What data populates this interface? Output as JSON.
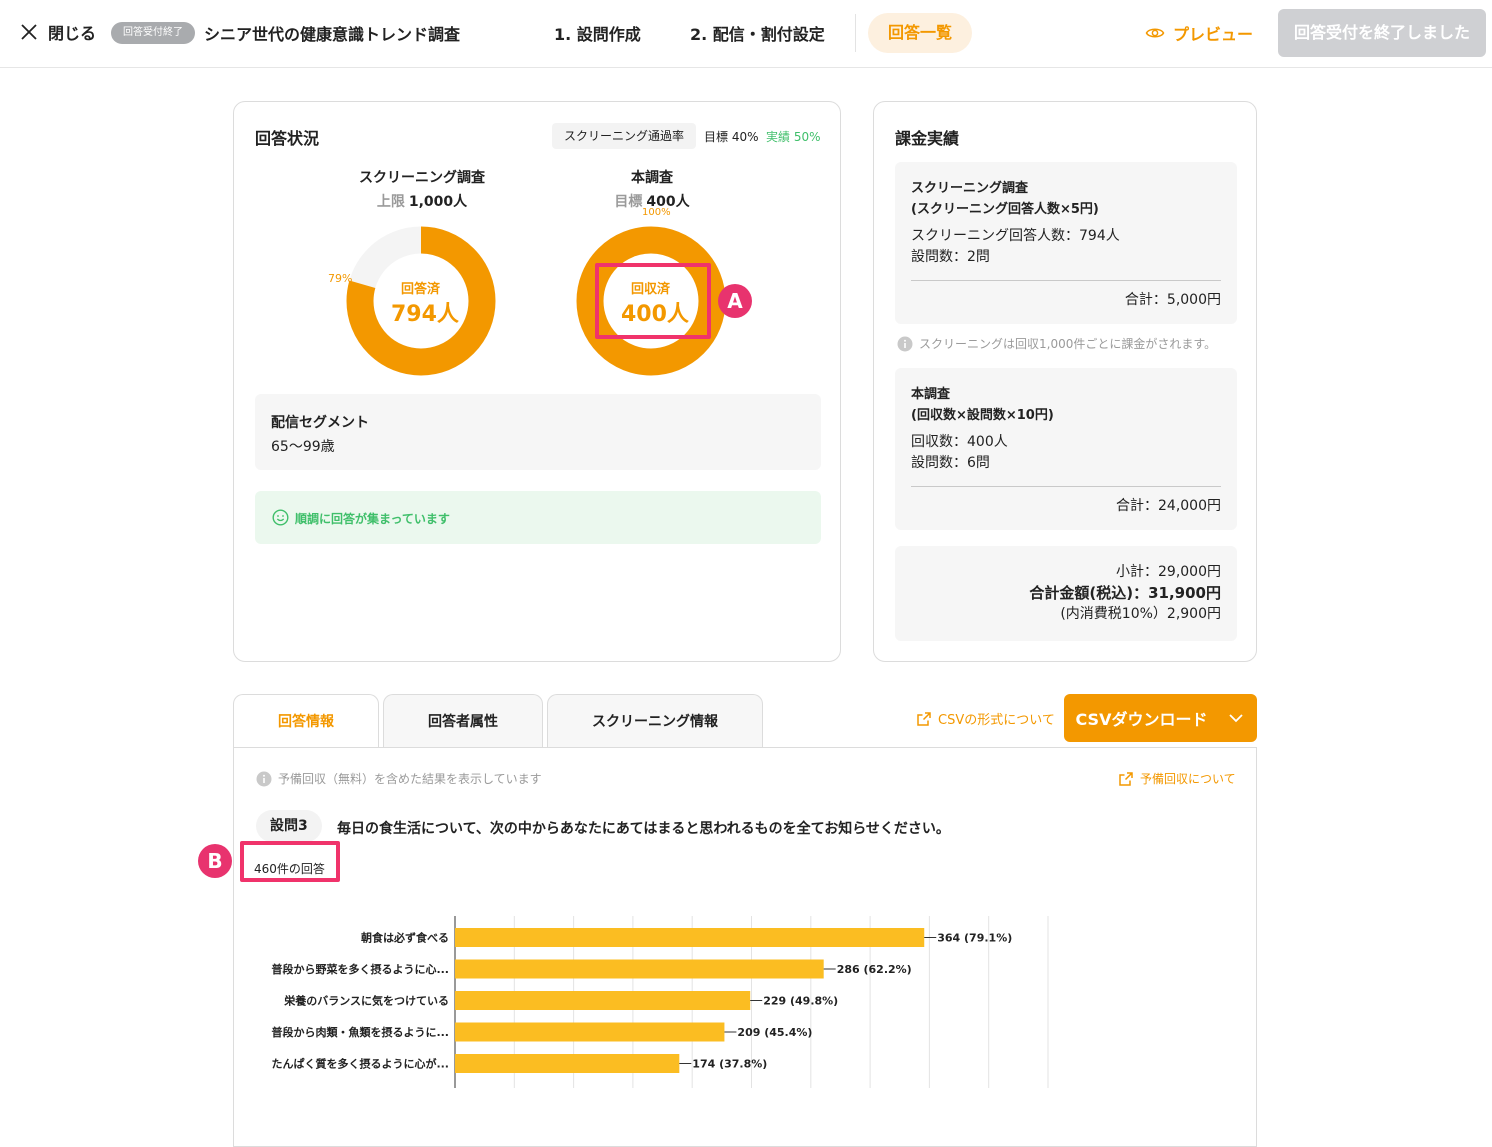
{
  "header": {
    "close_label": "閉じる",
    "status_badge": "回答受付終了",
    "survey_title": "シニア世代の健康意識トレンド調査",
    "step1": "1. 設問作成",
    "step2": "2. 配信・割付設定",
    "active_tab": "回答一覧",
    "preview_label": "プレビュー",
    "end_button": "回答受付を終了しました"
  },
  "status": {
    "title": "回答状況",
    "rate_label": "スクリーニング通過率",
    "rate_target": "目標 40%",
    "rate_actual": "実績 50%",
    "screening": {
      "head": "スクリーニング調査",
      "sub_key": "上限",
      "sub_val": "1,000人",
      "pct_label": "79%",
      "center_key": "回答済",
      "center_val": "794人",
      "fraction": 0.794
    },
    "main": {
      "head": "本調査",
      "sub_key": "目標",
      "sub_val": "400人",
      "pct_label": "100%",
      "center_key": "回収済",
      "center_val": "400人",
      "fraction": 1.0
    },
    "segment_title": "配信セグメント",
    "segment_value": "65〜99歳",
    "good_message": "順調に回答が集まっています"
  },
  "billing": {
    "title": "課金実績",
    "screening": {
      "head1": "スクリーニング調査",
      "head2": "(スクリーニング回答人数×5円)",
      "line1": "スクリーニング回答人数：794人",
      "line2": "設問数：2問",
      "sum": "合計：5,000円"
    },
    "note": "スクリーニングは回収1,000件ごとに課金がされます。",
    "main": {
      "head1": "本調査",
      "head2": "(回収数×設問数×10円)",
      "line1": "回収数：400人",
      "line2": "設問数：6問",
      "sum": "合計：24,000円"
    },
    "subtotal": "小計：29,000円",
    "total": "合計金額(税込)：31,900円",
    "tax": "(内消費税10%）2,900円"
  },
  "tabs": [
    "回答情報",
    "回答者属性",
    "スクリーニング情報"
  ],
  "csv": {
    "format_link": "CSVの形式について",
    "download_button": "CSVダウンロード"
  },
  "results": {
    "info": "予備回収（無料）を含めた結果を表示しています",
    "spare_link": "予備回収について",
    "question_no": "設問3",
    "question_text": "毎日の食生活について、次の中からあなたにあてはまると思われるものを全てお知らせください。",
    "response_count": "460件の回答"
  },
  "annotations": {
    "a": "A",
    "b": "B"
  },
  "colors": {
    "accent": "#f39800",
    "bar": "#fbbd22",
    "success": "#3fbf6a",
    "annotation": "#f0336b"
  },
  "chart_data": {
    "type": "bar",
    "orientation": "horizontal",
    "categories": [
      "朝食は必ず食べる",
      "普段から野菜を多く摂るように心...",
      "栄養のバランスに気をつけている",
      "普段から肉類・魚類を摂るように...",
      "たんぱく質を多く摂るように心が..."
    ],
    "values": [
      364,
      286,
      229,
      209,
      174
    ],
    "value_labels": [
      "364 (79.1%)",
      "286 (62.2%)",
      "229 (49.8%)",
      "209 (45.4%)",
      "174 (37.8%)"
    ],
    "xlim": [
      0,
      460
    ],
    "grid": true
  }
}
